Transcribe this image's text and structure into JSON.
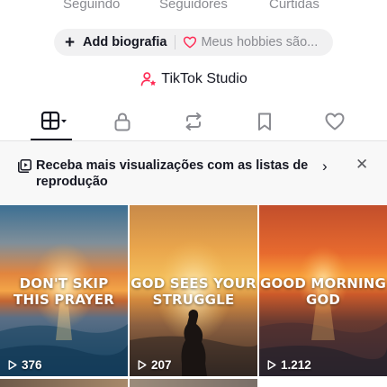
{
  "profile_stats": {
    "following_label": "Seguindo",
    "followers_label": "Seguidores",
    "likes_label": "Curtidas"
  },
  "bio": {
    "add_label": "Add biografia",
    "hint": "Meus hobbies são...",
    "add_icon": "plus-icon",
    "hint_icon": "heart-outline-icon",
    "hint_icon_color": "#fe2c55"
  },
  "studio": {
    "label": "TikTok Studio",
    "icon": "person-star-icon",
    "icon_color": "#fe2c55"
  },
  "tabs": [
    {
      "icon": "grid-icon",
      "name": "videos",
      "active": true
    },
    {
      "icon": "lock-icon",
      "name": "private"
    },
    {
      "icon": "repost-icon",
      "name": "reposts"
    },
    {
      "icon": "bookmark-icon",
      "name": "favorites"
    },
    {
      "icon": "heart-icon",
      "name": "liked"
    }
  ],
  "banner": {
    "text": "Receba mais visualizações com as listas de reprodução",
    "icon": "playlist-icon",
    "chevron_icon": "chevron-right-icon",
    "close_icon": "close-icon"
  },
  "videos": [
    {
      "title_line1": "DON'T SKIP",
      "title_line2": "THIS PRAYER",
      "views": "376"
    },
    {
      "title_line1": "GOD SEES YOUR",
      "title_line2": "STRUGGLE",
      "views": "207"
    },
    {
      "title_line1": "GOOD MORNING",
      "title_line2": "GOD",
      "views": "1.212"
    }
  ],
  "colors": {
    "accent": "#fe2c55",
    "text_primary": "#161823",
    "text_secondary": "#8a8b91",
    "pill_bg": "#f1f1f2"
  }
}
